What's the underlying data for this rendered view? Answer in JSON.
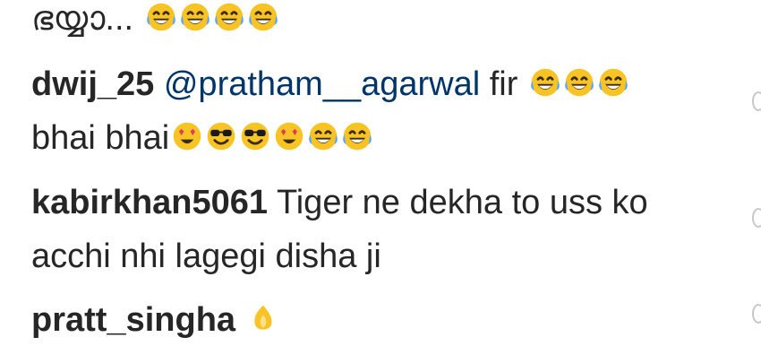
{
  "comments": [
    {
      "username": "",
      "text": "ഭയ്യാ...",
      "emojis": [
        "laughing-tears",
        "laughing-tears",
        "laughing-tears",
        "laughing-tears"
      ]
    },
    {
      "username": "dwij_25",
      "mention": "@pratham__agarwal",
      "text": "fir",
      "emojis": [
        "laughing-tears",
        "laughing-tears",
        "laughing-tears"
      ],
      "text2": "bhai bhai",
      "emojis2": [
        "heart-eyes",
        "sunglasses",
        "sunglasses",
        "heart-eyes",
        "laughing-tears",
        "laughing-tears"
      ]
    },
    {
      "username": "kabirkhan5061",
      "text": "Tiger ne dekha to uss ko acchi nhi lagegi disha ji"
    },
    {
      "username": "pratt_singha",
      "text": "",
      "emojis": [
        "fire"
      ]
    }
  ],
  "colors": {
    "text": "#262626",
    "mention": "#003569",
    "emoji_yellow": "#f7c325",
    "like_outline": "#c7c7c7"
  }
}
